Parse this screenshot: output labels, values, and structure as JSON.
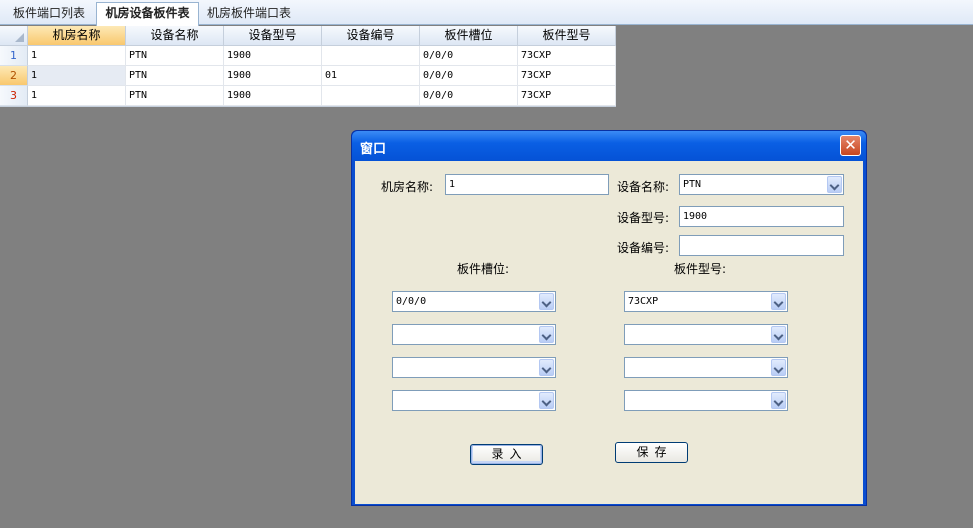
{
  "tabs": [
    {
      "label": "板件端口列表"
    },
    {
      "label": "机房设备板件表"
    },
    {
      "label": "机房板件端口表"
    }
  ],
  "grid": {
    "columns": [
      "机房名称",
      "设备名称",
      "设备型号",
      "设备编号",
      "板件槽位",
      "板件型号"
    ],
    "rows": [
      {
        "num": "1",
        "cells": [
          "1",
          "PTN",
          "1900",
          "",
          "0/0/0",
          "73CXP"
        ]
      },
      {
        "num": "2",
        "cells": [
          "1",
          "PTN",
          "1900",
          "01",
          "0/0/0",
          "73CXP"
        ]
      },
      {
        "num": "3",
        "cells": [
          "1",
          "PTN",
          "1900",
          "",
          "0/0/0",
          "73CXP"
        ]
      }
    ]
  },
  "dialog": {
    "title": "窗口",
    "close": "✕",
    "room_name_label": "机房名称:",
    "room_name_value": "1",
    "device_name_label": "设备名称:",
    "device_name_value": "PTN",
    "device_model_label": "设备型号:",
    "device_model_value": "1900",
    "device_code_label": "设备编号:",
    "device_code_value": "",
    "slot_header": "板件槽位:",
    "board_model_header": "板件型号:",
    "slots": [
      "0/0/0",
      "",
      "",
      ""
    ],
    "board_models": [
      "73CXP",
      "",
      "",
      ""
    ],
    "enter_button": "录入",
    "save_button": "保存"
  }
}
